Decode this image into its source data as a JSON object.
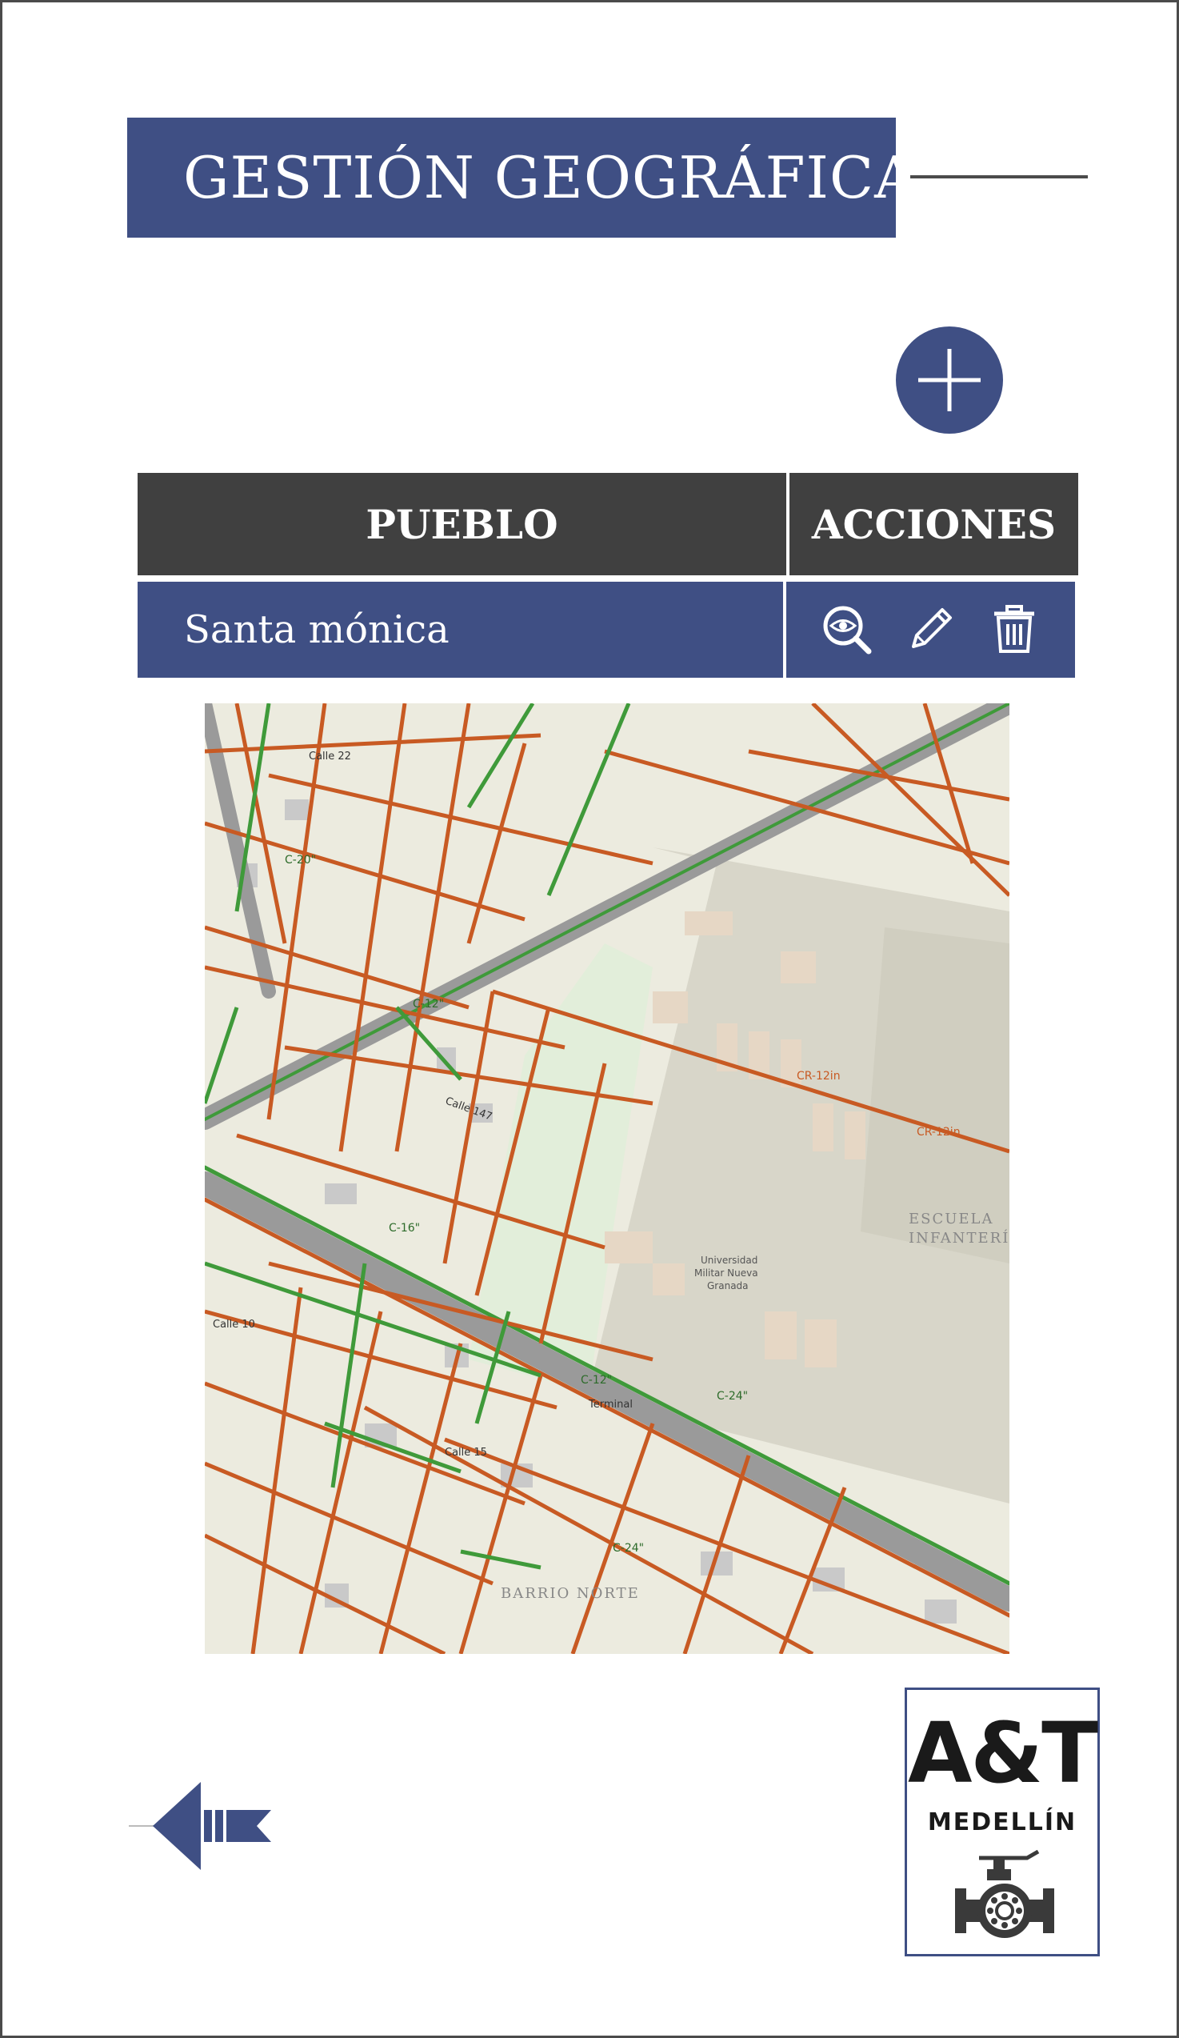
{
  "header": {
    "title": "GESTIÓN GEOGRÁFICA"
  },
  "add_button": {
    "icon": "plus-icon"
  },
  "table": {
    "columns": [
      "PUEBLO",
      "ACCIONES"
    ],
    "rows": [
      {
        "pueblo": "Santa mónica",
        "actions": [
          "view-icon",
          "edit-icon",
          "delete-icon"
        ]
      }
    ]
  },
  "map": {
    "labels": [
      "Universidad Militar Nueva Granada",
      "ESCUELA INFANTERÍA",
      "BARRIO NORTE",
      "Terminal",
      "Calle 22",
      "Calle 10",
      "Calle 15",
      "Calle 147",
      "C-12\"",
      "C-16\"",
      "C-20\"",
      "C-24\"",
      "CR-12in"
    ]
  },
  "back_button": {
    "icon": "back-arrow-icon"
  },
  "logo": {
    "title": "A&T",
    "subtitle": "MEDELLÍN"
  },
  "colors": {
    "primary": "#3f4f84",
    "header_dark": "#404040",
    "pipe_red": "#c85a23",
    "pipe_green": "#3f9a3a"
  }
}
